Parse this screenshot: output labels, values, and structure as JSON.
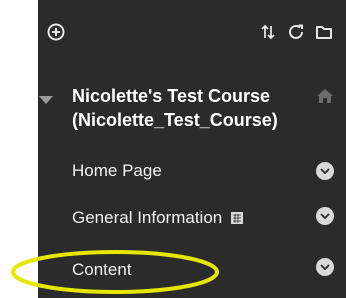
{
  "toolbar": {
    "icons": [
      "add-menu-item-icon",
      "reorder-icon",
      "refresh-icon",
      "folder-view-icon"
    ]
  },
  "course": {
    "title": "Nicolette's Test Course",
    "id": "(Nicolette_Test_Course)"
  },
  "items": [
    {
      "label": "Home Page"
    },
    {
      "label": "General Information"
    },
    {
      "label": "Content"
    }
  ],
  "colors": {
    "menu_bg": "#2b2b2b",
    "text": "#f2f2f2",
    "highlight_ellipse": "#e6e600"
  }
}
